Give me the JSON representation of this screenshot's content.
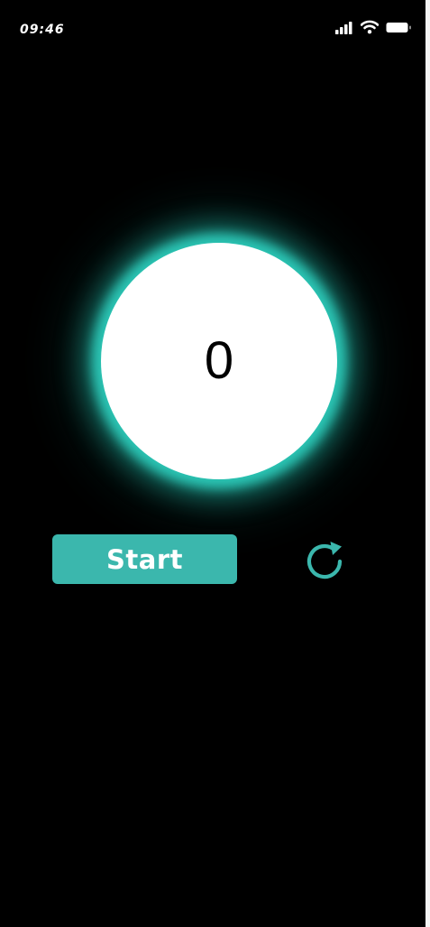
{
  "status_bar": {
    "time": "09:46",
    "icons": [
      "signal-icon",
      "wifi-icon",
      "battery-icon"
    ]
  },
  "timer": {
    "value": "0"
  },
  "controls": {
    "start_label": "Start",
    "reset_icon": "reset-icon"
  },
  "colors": {
    "background": "#000000",
    "accent": "#3bb7ad",
    "glow": "#2cc9b8",
    "circle": "#ffffff",
    "text_on_accent": "#ffffff",
    "counter_text": "#000000"
  }
}
